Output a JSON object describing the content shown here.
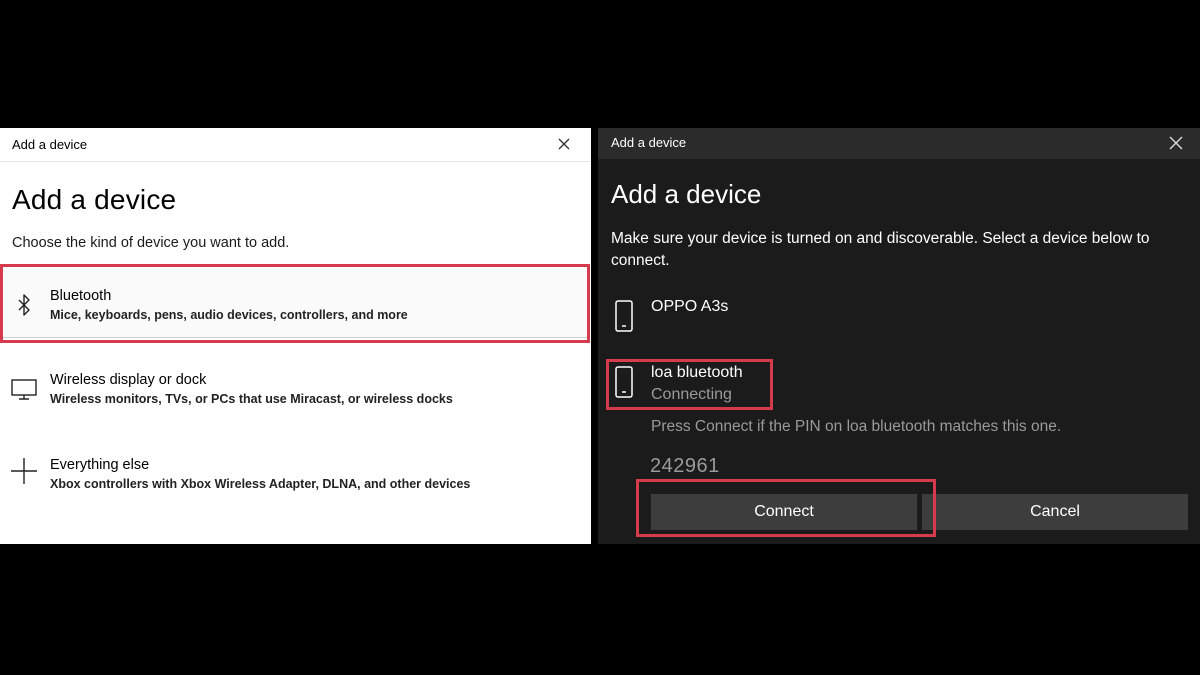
{
  "left_dialog": {
    "window_title": "Add a device",
    "heading": "Add a device",
    "subheading": "Choose the kind of device you want to add.",
    "options": [
      {
        "name": "Bluetooth",
        "description": "Mice, keyboards, pens, audio devices, controllers, and more",
        "icon": "bluetooth-icon"
      },
      {
        "name": "Wireless display or dock",
        "description": "Wireless monitors, TVs, or PCs that use Miracast, or wireless docks",
        "icon": "monitor-icon"
      },
      {
        "name": "Everything else",
        "description": "Xbox controllers with Xbox Wireless Adapter, DLNA, and other devices",
        "icon": "plus-icon"
      }
    ]
  },
  "right_dialog": {
    "window_title": "Add a device",
    "heading": "Add a device",
    "instructions": "Make sure your device is turned on and discoverable. Select a device below to connect.",
    "devices": [
      {
        "name": "OPPO A3s",
        "status": "",
        "icon": "phone-icon"
      },
      {
        "name": "loa bluetooth",
        "status": "Connecting",
        "icon": "phone-icon"
      }
    ],
    "pin_message": "Press Connect if the PIN on loa bluetooth matches this one.",
    "pin": "242961",
    "connect_label": "Connect",
    "cancel_label": "Cancel"
  },
  "colors": {
    "highlight": "#d63b4d",
    "dark_bg": "#1b1b1b",
    "dark_titlebar": "#2b2b2b",
    "button_bg": "#3d3d3d",
    "muted_text": "#9a9a9a"
  }
}
